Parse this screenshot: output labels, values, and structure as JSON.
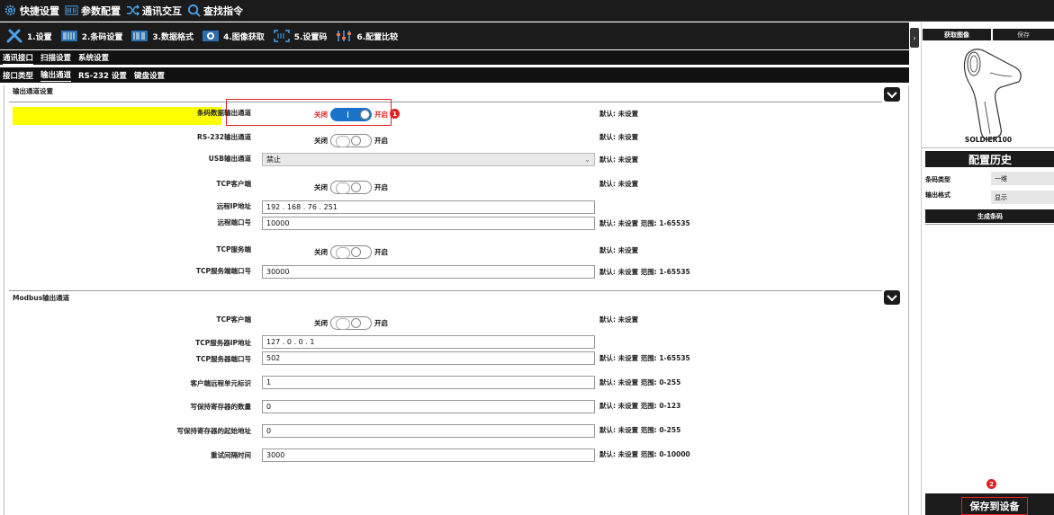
{
  "topbar": {
    "items": [
      {
        "label": "快捷设置",
        "icon": "gear-icon"
      },
      {
        "label": "参数配置",
        "icon": "barcode-icon"
      },
      {
        "label": "通讯交互",
        "icon": "shuffle-icon"
      },
      {
        "label": "查找指令",
        "icon": "search-icon"
      }
    ]
  },
  "tabs": [
    {
      "label": "1.设置",
      "icon": "wrench-icon"
    },
    {
      "label": "2.条码设置",
      "icon": "barcode-icon"
    },
    {
      "label": "3.数据格式",
      "icon": "barcode-icon"
    },
    {
      "label": "4.图像获取",
      "icon": "camera-icon"
    },
    {
      "label": "5.设置码",
      "icon": "scan-frame-icon"
    },
    {
      "label": "6.配置比较",
      "icon": "sliders-icon"
    }
  ],
  "subtabs1": [
    "通讯接口",
    "扫描设置",
    "系统设置"
  ],
  "subtabs2": [
    "接口类型",
    "输出通道",
    "RS-232 设置",
    "键盘设置"
  ],
  "section1": {
    "title": "输出通道设置",
    "rows": {
      "barcode_out": {
        "label": "条码数据输出通道",
        "off": "关闭",
        "on": "开启",
        "default": "默认: 未设置",
        "badge": "1"
      },
      "rs232_out": {
        "label": "RS-232输出通道",
        "off": "关闭",
        "on": "开启",
        "default": "默认: 未设置"
      },
      "usb_out": {
        "label": "USB输出通道",
        "value": "禁止",
        "default": "默认: 未设置"
      },
      "tcp_client": {
        "label": "TCP客户端",
        "off": "关闭",
        "on": "开启",
        "default": "默认: 未设置"
      },
      "remote_ip": {
        "label": "远程IP地址",
        "value": "192  .  168  .  76  .  251"
      },
      "remote_port": {
        "label": "远程端口号",
        "value": "10000",
        "default": "默认: 未设置  范围: 1-65535"
      },
      "tcp_server": {
        "label": "TCP服务端",
        "off": "关闭",
        "on": "开启",
        "default": "默认: 未设置"
      },
      "tcp_server_port": {
        "label": "TCP服务端端口号",
        "value": "30000",
        "default": "默认: 未设置  范围: 1-65535"
      }
    }
  },
  "section2": {
    "title": "Modbus输出通道",
    "rows": {
      "tcp_client": {
        "label": "TCP客户端",
        "off": "关闭",
        "on": "开启",
        "default": "默认: 未设置"
      },
      "server_ip": {
        "label": "TCP服务器IP地址",
        "value": "127  .  0  .  0  .  1"
      },
      "server_port": {
        "label": "TCP服务器端口号",
        "value": "502",
        "default": "默认: 未设置  范围: 1-65535"
      },
      "unit_id": {
        "label": "客户端远程单元标识",
        "value": "1",
        "default": "默认: 未设置  范围: 0-255"
      },
      "reg_count": {
        "label": "写保持寄存器的数量",
        "value": "0",
        "default": "默认: 未设置  范围: 0-123"
      },
      "reg_start": {
        "label": "写保持寄存器的起始地址",
        "value": "0",
        "default": "默认: 未设置  范围: 0-255"
      },
      "retry": {
        "label": "重试间隔时间",
        "value": "3000",
        "default": "默认: 未设置  范围: 0-10000"
      }
    }
  },
  "right": {
    "get_image": "获取图像",
    "save": "保存",
    "device_name": "SOLDIER100",
    "history_title": "配置历史",
    "history": [
      {
        "key": "条码类型",
        "value": "一维"
      },
      {
        "key": "输出格式",
        "value": "显示"
      }
    ],
    "gen_barcode": "生成条码",
    "badge": "2",
    "save_to_device": "保存到设备"
  },
  "colors": {
    "accent": "#1a73c8",
    "highlight": "#ffff00",
    "badge": "#e02020",
    "dark": "#1b1b1b"
  }
}
